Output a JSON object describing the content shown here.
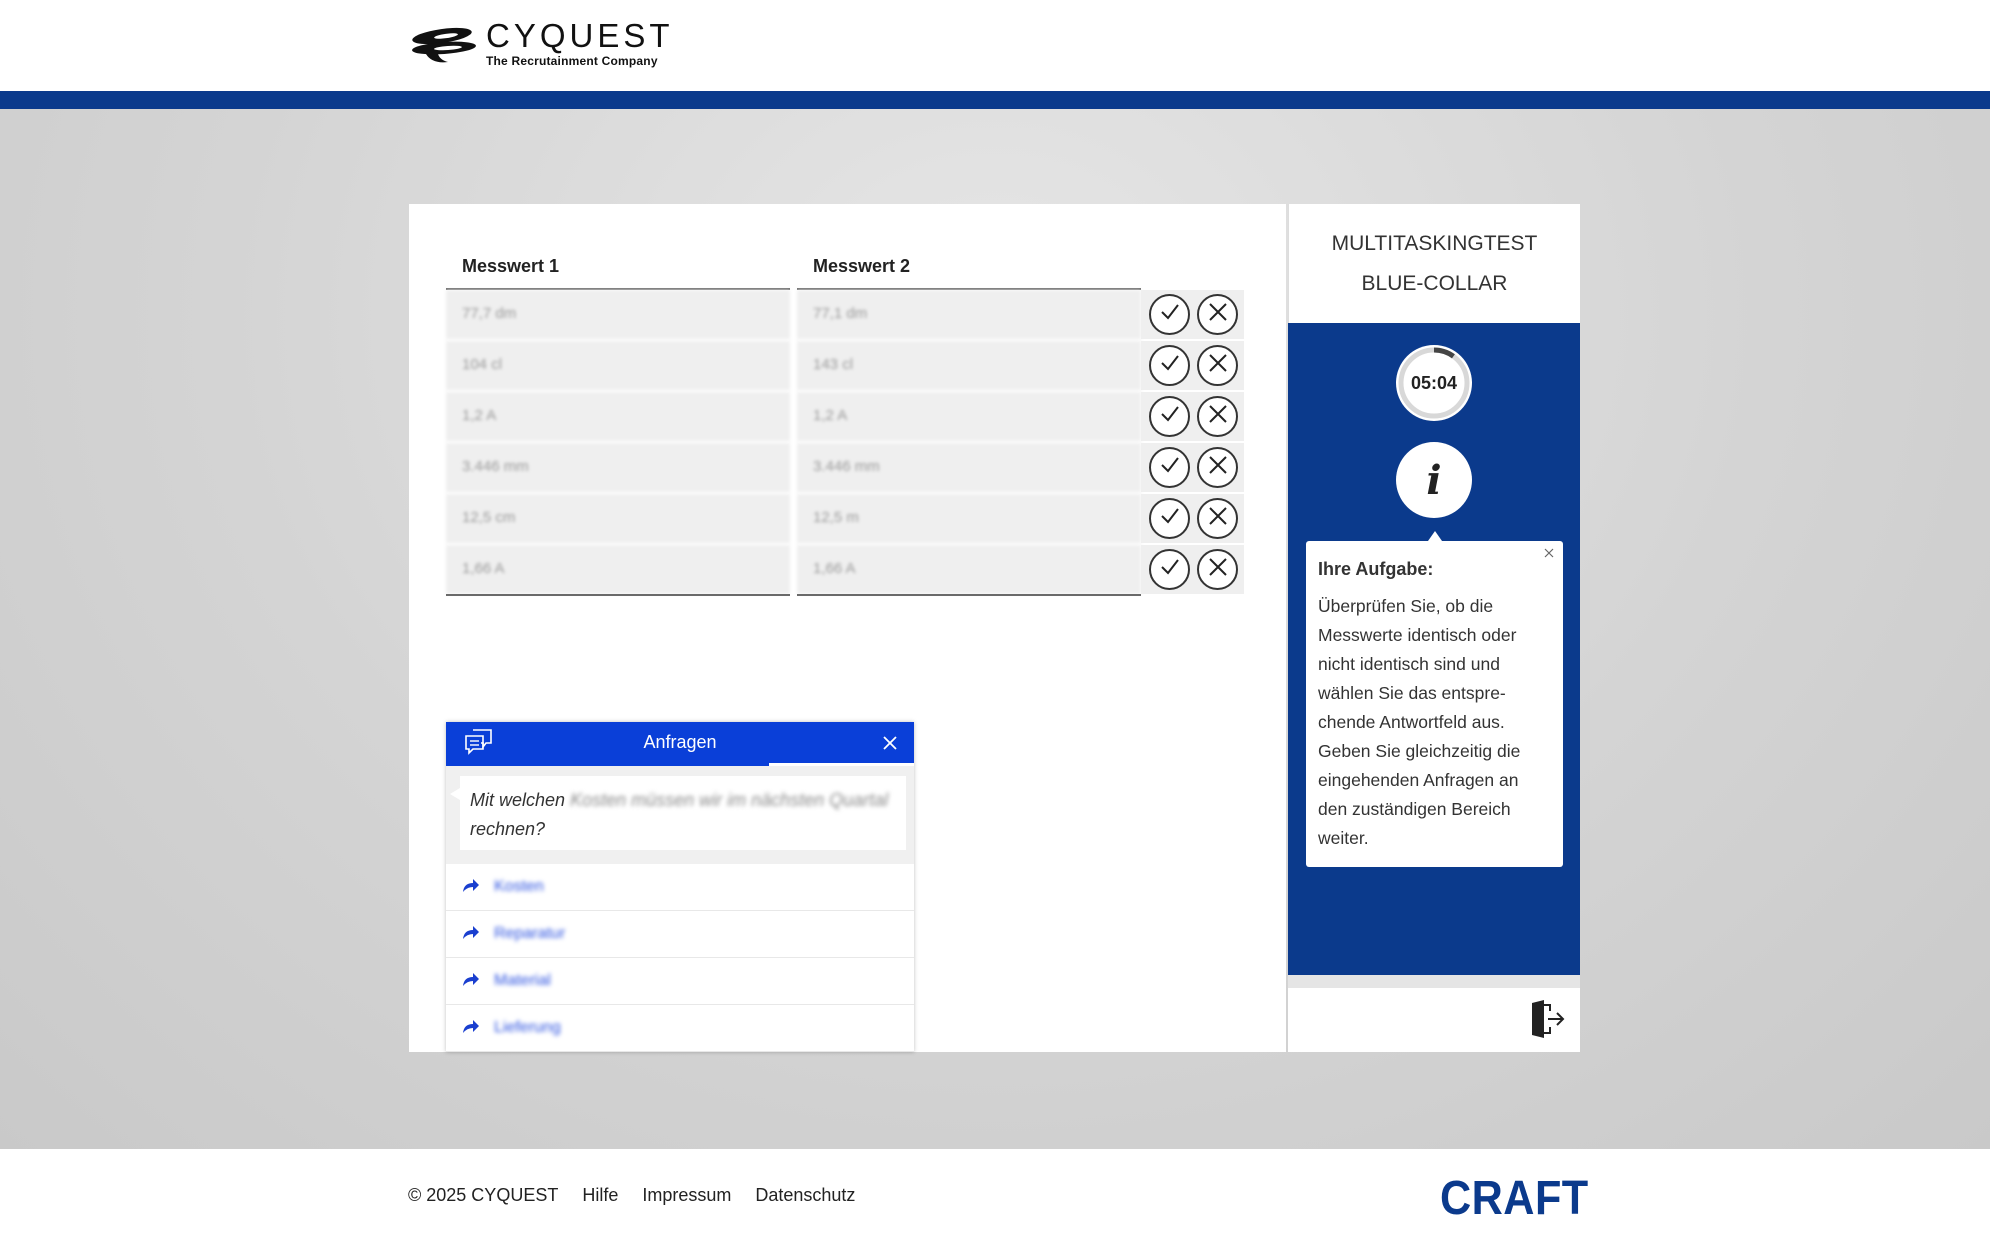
{
  "header": {
    "logo_name": "CYQUEST",
    "logo_tagline": "The Recrutainment Company"
  },
  "table": {
    "col1_header": "Messwert 1",
    "col2_header": "Messwert 2",
    "rows": [
      {
        "v1": "77,7 dm",
        "v2": "77,1 dm"
      },
      {
        "v1": "104 cl",
        "v2": "143 cl"
      },
      {
        "v1": "1,2 A",
        "v2": "1,2 A"
      },
      {
        "v1": "3.446 mm",
        "v2": "3.446 mm"
      },
      {
        "v1": "12,5 cm",
        "v2": "12,5 m"
      },
      {
        "v1": "1,66 A",
        "v2": "1,66 A"
      }
    ]
  },
  "requests": {
    "title": "Anfragen",
    "question_prefix": "Mit welchen",
    "question_blurred": "Kosten müssen wir im nächsten Quartal",
    "question_suffix": "rechnen?",
    "options": [
      "Kosten",
      "Reparatur",
      "Material",
      "Lieferung"
    ]
  },
  "side": {
    "title_line1": "MULTITASKINGTEST",
    "title_line2": "BLUE-COLLAR",
    "timer": "05:04",
    "timer_remaining_fraction": 0.9,
    "info_glyph": "i",
    "tip_title": "Ihre Aufgabe:",
    "tip_text": "Überprüfen Sie, ob die Messwerte identisch oder nicht identisch sind und wählen Sie das entspre-chende Antwortfeld aus. Geben Sie gleichzeitig die eingehenden Anfragen an den zuständigen Bereich weiter."
  },
  "footer": {
    "copyright": "© 2025 CYQUEST",
    "links": [
      "Hilfe",
      "Impressum",
      "Datenschutz"
    ],
    "brand": "CRAFT"
  },
  "colors": {
    "navy": "#0b3a8c",
    "request_blue": "#0a3fd8"
  },
  "icons": {
    "check": "check-icon",
    "cross": "close-icon",
    "chat": "chat-bubbles-icon",
    "forward": "forward-arrow-icon",
    "exit": "exit-door-icon"
  }
}
